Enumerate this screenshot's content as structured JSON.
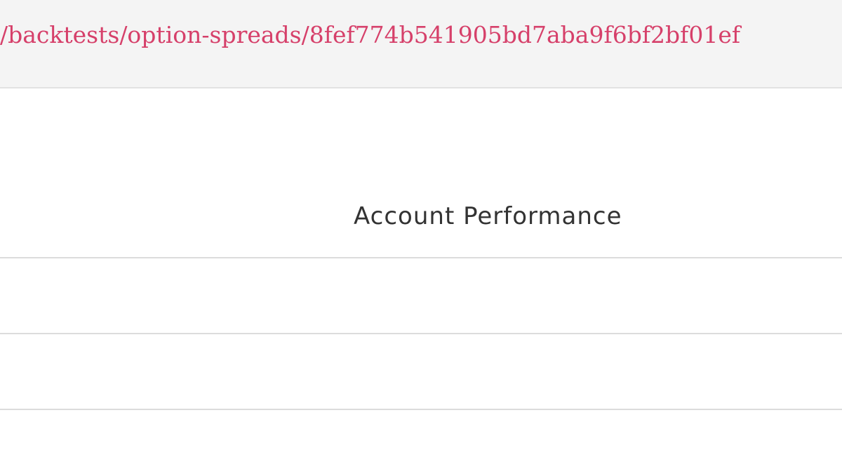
{
  "code_block": {
    "url_path": "/backtests/option-spreads/8fef774b541905bd7aba9f6bf2bf01ef",
    "link_color": "#d6406a"
  },
  "table": {
    "header": "Account Performance"
  }
}
